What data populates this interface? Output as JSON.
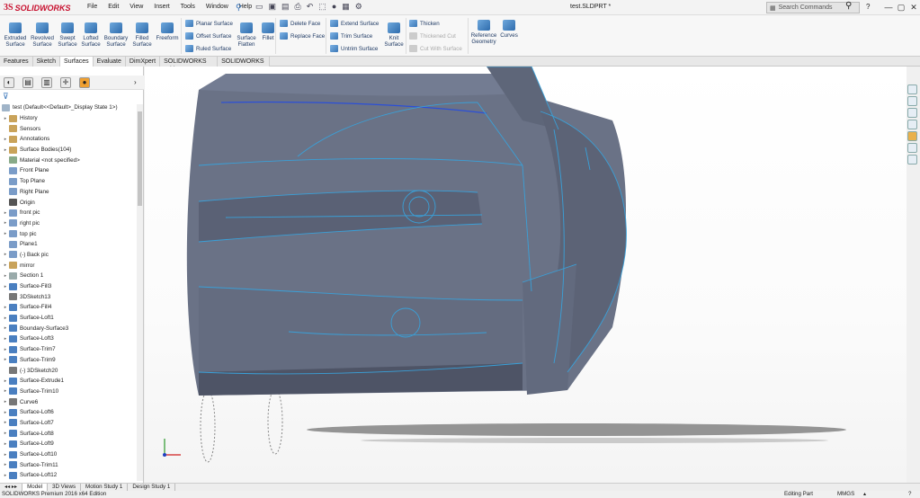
{
  "app": {
    "brand_ds": "3S",
    "brand_name": "SOLIDWORKS",
    "doc_title": "test.SLDPRT *",
    "search_placeholder": "Search Commands"
  },
  "menu": [
    "File",
    "Edit",
    "View",
    "Insert",
    "Tools",
    "Window",
    "Help"
  ],
  "ribbon": {
    "large": [
      {
        "label1": "Extruded",
        "label2": "Surface"
      },
      {
        "label1": "Revolved",
        "label2": "Surface"
      },
      {
        "label1": "Swept",
        "label2": "Surface"
      },
      {
        "label1": "Lofted",
        "label2": "Surface"
      },
      {
        "label1": "Boundary",
        "label2": "Surface"
      },
      {
        "label1": "Filled",
        "label2": "Surface"
      },
      {
        "label1": "Freeform",
        "label2": ""
      },
      {
        "label1": "Surface",
        "label2": "Flatten"
      },
      {
        "label1": "Fillet",
        "label2": ""
      }
    ],
    "group1": [
      "Planar Surface",
      "Offset Surface",
      "Ruled Surface"
    ],
    "group2": [
      "Delete Face",
      "Replace Face"
    ],
    "group3": [
      "Extend Surface",
      "Trim Surface",
      "Untrim Surface"
    ],
    "knit": {
      "label1": "Knit",
      "label2": "Surface"
    },
    "group4": [
      "Thicken",
      "Thickened Cut",
      "Cut With Surface"
    ],
    "ref": {
      "label1": "Reference",
      "label2": "Geometry"
    },
    "curves": "Curves"
  },
  "tabs": [
    "Features",
    "Sketch",
    "Surfaces",
    "Evaluate",
    "DimXpert",
    "SOLIDWORKS Add-Ins",
    "SOLIDWORKS MBD"
  ],
  "active_tab": "Surfaces",
  "tree": {
    "root": "test  (Default<<Default>_Display State 1>)",
    "items": [
      {
        "label": "History",
        "arrow": true,
        "color": "#c9a35a"
      },
      {
        "label": "Sensors",
        "arrow": false,
        "color": "#c9a35a"
      },
      {
        "label": "Annotations",
        "arrow": true,
        "color": "#c9a35a"
      },
      {
        "label": "Surface Bodies(104)",
        "arrow": true,
        "color": "#c9a35a"
      },
      {
        "label": "Material <not specified>",
        "arrow": false,
        "color": "#8a8"
      },
      {
        "label": "Front Plane",
        "arrow": false,
        "color": "#7a9cc8"
      },
      {
        "label": "Top Plane",
        "arrow": false,
        "color": "#7a9cc8"
      },
      {
        "label": "Right Plane",
        "arrow": false,
        "color": "#7a9cc8"
      },
      {
        "label": "Origin",
        "arrow": false,
        "color": "#555"
      },
      {
        "label": "front pic",
        "arrow": true,
        "color": "#7a9cc8"
      },
      {
        "label": "right pic",
        "arrow": true,
        "color": "#7a9cc8"
      },
      {
        "label": "top pic",
        "arrow": true,
        "color": "#7a9cc8"
      },
      {
        "label": "Plane1",
        "arrow": false,
        "color": "#7a9cc8"
      },
      {
        "label": "(-) Back pic",
        "arrow": true,
        "color": "#7a9cc8"
      },
      {
        "label": "mirror",
        "arrow": true,
        "color": "#c9a35a"
      },
      {
        "label": "Section 1",
        "arrow": true,
        "color": "#9aa"
      },
      {
        "label": "Surface-Fill3",
        "arrow": true,
        "color": "#4a7fc0"
      },
      {
        "label": "3DSketch13",
        "arrow": false,
        "color": "#777"
      },
      {
        "label": "Surface-Fill4",
        "arrow": true,
        "color": "#4a7fc0"
      },
      {
        "label": "Surface-Loft1",
        "arrow": true,
        "color": "#4a7fc0"
      },
      {
        "label": "Boundary-Surface3",
        "arrow": true,
        "color": "#4a7fc0"
      },
      {
        "label": "Surface-Loft3",
        "arrow": true,
        "color": "#4a7fc0"
      },
      {
        "label": "Surface-Trim7",
        "arrow": true,
        "color": "#4a7fc0"
      },
      {
        "label": "Surface-Trim9",
        "arrow": true,
        "color": "#4a7fc0"
      },
      {
        "label": "(-) 3DSketch20",
        "arrow": false,
        "color": "#777"
      },
      {
        "label": "Surface-Extrude1",
        "arrow": true,
        "color": "#4a7fc0"
      },
      {
        "label": "Surface-Trim10",
        "arrow": true,
        "color": "#4a7fc0"
      },
      {
        "label": "Curve6",
        "arrow": true,
        "color": "#777"
      },
      {
        "label": "Surface-Loft6",
        "arrow": true,
        "color": "#4a7fc0"
      },
      {
        "label": "Surface-Loft7",
        "arrow": true,
        "color": "#4a7fc0"
      },
      {
        "label": "Surface-Loft8",
        "arrow": true,
        "color": "#4a7fc0"
      },
      {
        "label": "Surface-Loft9",
        "arrow": true,
        "color": "#4a7fc0"
      },
      {
        "label": "Surface-Loft10",
        "arrow": true,
        "color": "#4a7fc0"
      },
      {
        "label": "Surface-Trim11",
        "arrow": true,
        "color": "#4a7fc0"
      },
      {
        "label": "Surface-Loft12",
        "arrow": true,
        "color": "#4a7fc0"
      }
    ]
  },
  "bottom_tabs": [
    "Model",
    "3D Views",
    "Motion Study 1",
    "Design Study 1"
  ],
  "status": {
    "edition": "SOLIDWORKS Premium 2016 x64 Edition",
    "mode": "Editing Part",
    "units": "MMGS"
  },
  "colors": {
    "model_fill": "#6a7286",
    "edge": "#3aa0d8",
    "brand": "#c8102e"
  }
}
